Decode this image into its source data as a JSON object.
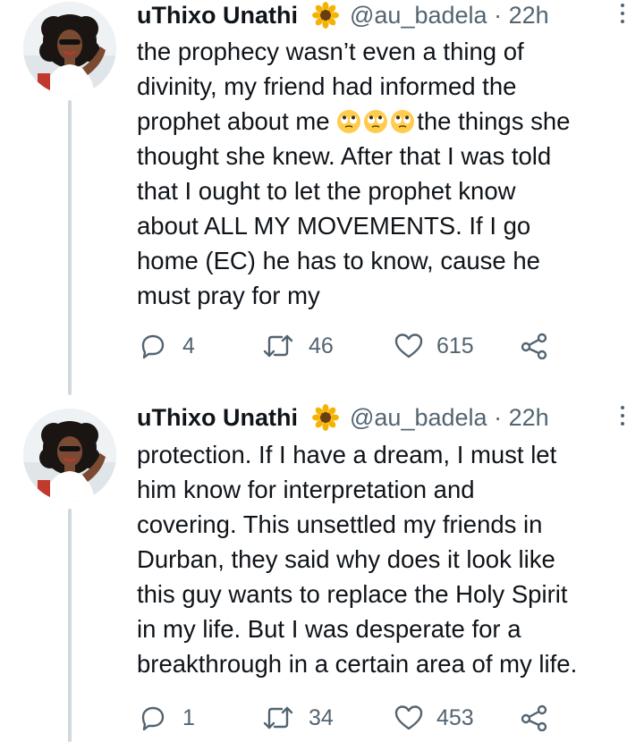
{
  "colors": {
    "text": "#0f1419",
    "secondary": "#536471",
    "thread_line": "#cfd9de",
    "background": "#ffffff"
  },
  "tweets": [
    {
      "author": {
        "name": "uThixo Unathi",
        "name_emoji": "sunflower-icon",
        "handle": "@au_badela",
        "time": "22h",
        "avatar": "avatar"
      },
      "text_lines": [
        "the prophecy wasn’t even a thing of",
        "divinity, my friend had informed the",
        {
          "before": "prophet about me ",
          "emoji": "face-with-rolling-eyes-icon",
          "emoji_count": 3,
          "after": "the things she"
        },
        "thought she knew. After that I was told",
        "that I ought to let the prophet know",
        "about ALL MY MOVEMENTS. If I go",
        "home (EC) he has to know, cause he",
        "must pray for my"
      ],
      "line_0": "the prophecy wasn’t even a thing of",
      "line_1": "divinity, my friend had informed the",
      "line_2_before": "prophet about me ",
      "line_2_after": "the things she",
      "line_3": "thought she knew. After that I was told",
      "line_4": "that I ought to let the prophet know",
      "line_5": "about ALL MY MOVEMENTS. If I go",
      "line_6": "home (EC) he has to know, cause he",
      "line_7": "must pray for my",
      "replies": "4",
      "retweets": "46",
      "likes": "615"
    },
    {
      "author": {
        "name": "uThixo Unathi",
        "name_emoji": "sunflower-icon",
        "handle": "@au_badela",
        "time": "22h",
        "avatar": "avatar"
      },
      "line_0": "protection. If I have a dream, I must let",
      "line_1": "him know for interpretation and",
      "line_2": "covering. This unsettled my friends in",
      "line_3": "Durban, they said why does it look like",
      "line_4": "this guy wants to replace the Holy Spirit",
      "line_5": "in my life. But I was desperate for a",
      "line_6": "breakthrough in a certain area of my life.",
      "replies": "1",
      "retweets": "34",
      "likes": "453"
    }
  ],
  "separator": "·"
}
